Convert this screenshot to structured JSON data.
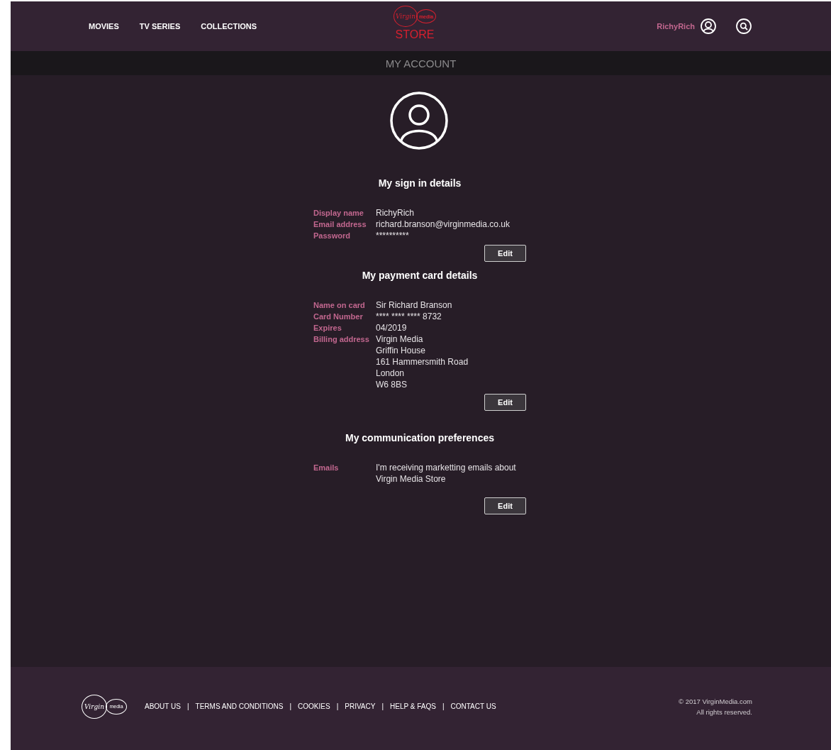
{
  "header": {
    "nav": [
      "MOVIES",
      "TV SERIES",
      "COLLECTIONS"
    ],
    "logo": {
      "script": "Virgin",
      "small": "media",
      "word": "STORE"
    },
    "user": "RichyRich"
  },
  "title_bar": "MY ACCOUNT",
  "sections": [
    {
      "title": "My sign in details",
      "rows": [
        {
          "label": "Display name",
          "lines": [
            "RichyRich"
          ]
        },
        {
          "label": "Email address",
          "lines": [
            "richard.branson@virginmedia.co.uk"
          ]
        },
        {
          "label": "Password",
          "lines": [
            "**********"
          ]
        }
      ],
      "button": "Edit"
    },
    {
      "title": "My payment card details",
      "rows": [
        {
          "label": "Name on card",
          "lines": [
            "Sir Richard Branson"
          ]
        },
        {
          "label": "Card Number",
          "lines": [
            "**** **** **** 8732"
          ]
        },
        {
          "label": "Expires",
          "lines": [
            "04/2019"
          ]
        },
        {
          "label": "Billing address",
          "lines": [
            "Virgin Media",
            "Griffin House",
            "161 Hammersmith Road",
            "London",
            "W6 8BS"
          ]
        }
      ],
      "button": "Edit"
    },
    {
      "title": "My communication preferences",
      "rows": [
        {
          "label": "Emails",
          "lines": [
            "I'm receiving marketting emails about Virgin Media Store"
          ]
        }
      ],
      "button": "Edit"
    }
  ],
  "footer": {
    "logo": {
      "script": "Virgin",
      "small": "media"
    },
    "links": [
      "ABOUT US",
      "TERMS AND CONDITIONS",
      "COOKIES",
      "PRIVACY",
      "HELP & FAQS",
      "CONTACT US"
    ],
    "separator": "|",
    "copyright": "© 2017 VirginMedia.com",
    "rights": "All rights reserved."
  }
}
